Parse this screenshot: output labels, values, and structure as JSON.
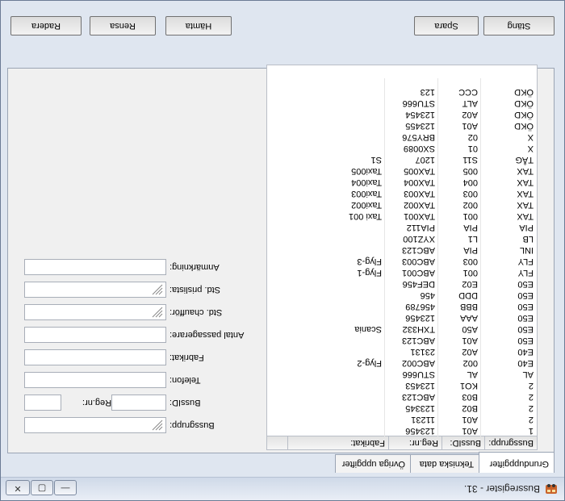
{
  "window": {
    "title": "Bussregister - 31.",
    "minimize_label": "—",
    "maximize_label": "▢",
    "close_label": "✕"
  },
  "tabs": [
    {
      "label": "Grunduppgifter"
    },
    {
      "label": "Tekniska data"
    },
    {
      "label": "Övriga uppgifter"
    }
  ],
  "form": {
    "bussgrupp_label": "Bussgrupp:",
    "bussid_label": "BussID:",
    "regnr_label": "Reg.nr:",
    "telefon_label": "Telefon:",
    "fabrikat_label": "Fabrikat:",
    "passagerare_label": "Antal passagerare:",
    "chauffor_label": "Std. chaufför:",
    "prislista_label": "Std. prislista:",
    "anmarkning_label": "Anmärkning:",
    "bussgrupp_value": "",
    "bussid_value": "",
    "regnr_value": "",
    "telefon_value": "",
    "fabrikat_value": "",
    "passagerare_value": "",
    "chauffor_value": "",
    "prislista_value": "",
    "anmarkning_value": ""
  },
  "table": {
    "columns": [
      "Bussgrupp:",
      "BussID:",
      "Reg.nr:",
      "Fabrikat:"
    ],
    "rows": [
      [
        "1",
        "A01",
        "123456",
        ""
      ],
      [
        "2",
        "A01",
        "11231",
        ""
      ],
      [
        "2",
        "B02",
        "123345",
        ""
      ],
      [
        "2",
        "B03",
        "ABC123",
        ""
      ],
      [
        "2",
        "KO1",
        "123453",
        ""
      ],
      [
        "AL",
        "AL",
        "STU666",
        ""
      ],
      [
        "E40",
        "002",
        "ABC002",
        "Flyg-2"
      ],
      [
        "E40",
        "A02",
        "23131",
        ""
      ],
      [
        "E50",
        "A01",
        "ABC123",
        ""
      ],
      [
        "E50",
        "A50",
        "TXH332",
        "Scania"
      ],
      [
        "E50",
        "AAA",
        "123456",
        ""
      ],
      [
        "E50",
        "BBB",
        "456789",
        ""
      ],
      [
        "E50",
        "DDD",
        "456",
        ""
      ],
      [
        "E50",
        "E02",
        "DEF456",
        ""
      ],
      [
        "FLY",
        "001",
        "ABC001",
        "Flyg-1"
      ],
      [
        "FLY",
        "003",
        "ABC003",
        "Flyg-3"
      ],
      [
        "INL",
        "PIA",
        "ABC123",
        ""
      ],
      [
        "LB",
        "L1",
        "XYZ100",
        ""
      ],
      [
        "PIA",
        "PIA",
        "PIA112",
        ""
      ],
      [
        "TAX",
        "001",
        "TAX001",
        "Taxi 001"
      ],
      [
        "TAX",
        "002",
        "TAX002",
        "Taxi002"
      ],
      [
        "TAX",
        "003",
        "TAX003",
        "Taxi003"
      ],
      [
        "TAX",
        "004",
        "TAX004",
        "Taxi004"
      ],
      [
        "TAX",
        "005",
        "TAX005",
        "Taxi005"
      ],
      [
        "TÅG",
        "S11",
        "1207",
        "S1"
      ],
      [
        "X",
        "01",
        "SX0089",
        ""
      ],
      [
        "X",
        "02",
        "BRY576",
        ""
      ],
      [
        "ÖKD",
        "A01",
        "123455",
        ""
      ],
      [
        "ÖKD",
        "A02",
        "123454",
        ""
      ],
      [
        "ÖKD",
        "ALT",
        "STU666",
        ""
      ],
      [
        "ÖKD",
        "CCC",
        "123",
        ""
      ]
    ]
  },
  "buttons": {
    "delete": "Radera",
    "clear": "Rensa",
    "fetch": "Hämta",
    "save": "Spara",
    "close": "Stäng"
  }
}
